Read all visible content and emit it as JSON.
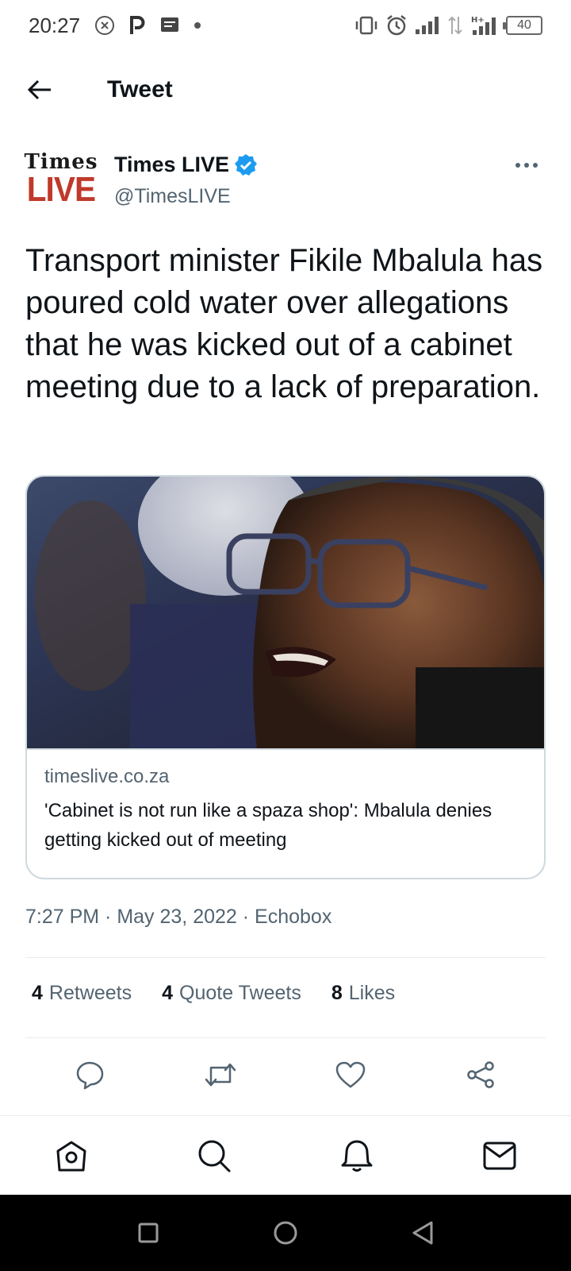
{
  "status_bar": {
    "time": "20:27",
    "battery": "40",
    "network": "H+"
  },
  "header": {
    "title": "Tweet"
  },
  "author": {
    "avatar_line1": "Times",
    "avatar_line2": "LIVE",
    "display_name": "Times LIVE",
    "handle": "@TimesLIVE",
    "verified": true
  },
  "tweet": {
    "text": "Transport minister Fikile Mbalula has poured cold water over allegations that he was kicked out of a cabinet meeting due to a lack of preparation."
  },
  "card": {
    "domain": "timeslive.co.za",
    "title": "'Cabinet is not run like a spaza shop': Mbalula denies getting kicked out of meeting"
  },
  "meta": {
    "time": "7:27 PM",
    "separator": " · ",
    "date": "May 23, 2022",
    "source": "Echobox"
  },
  "stats": {
    "retweets_count": "4",
    "retweets_label": "Retweets",
    "quotes_count": "4",
    "quotes_label": "Quote Tweets",
    "likes_count": "8",
    "likes_label": "Likes"
  },
  "colors": {
    "accent": "#1d9bf0",
    "secondary_text": "#536471",
    "brand_red": "#c0392b"
  },
  "icons": {
    "actions": [
      "reply-icon",
      "retweet-icon",
      "like-icon",
      "share-icon"
    ],
    "nav": [
      "home-icon",
      "search-icon",
      "notifications-icon",
      "messages-icon"
    ],
    "system": [
      "recents-icon",
      "home-circle-icon",
      "back-triangle-icon"
    ]
  }
}
